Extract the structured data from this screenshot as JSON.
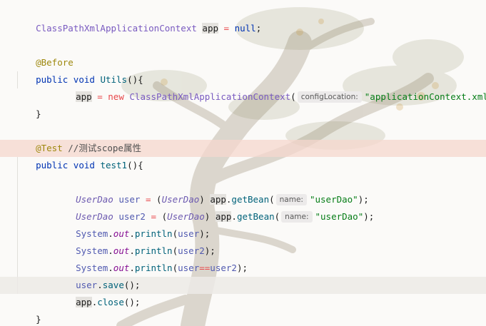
{
  "code": {
    "line1": {
      "type": "ClassPathXmlApplicationContext",
      "var": "app",
      "op": "=",
      "value": "null",
      "end": ";"
    },
    "line3": {
      "annotation": "@Before"
    },
    "line4": {
      "kw1": "public",
      "kw2": "void",
      "method": "Utils",
      "rest": "(){"
    },
    "line5": {
      "var": "app",
      "op": "=",
      "kw": "new",
      "type": "ClassPathXmlApplicationContext",
      "open": "(",
      "hint": "configLocation:",
      "str": "\"applicationContext.xml\"",
      "close": ");"
    },
    "line6": {
      "brace": "}"
    },
    "line8": {
      "annotation": "@Test",
      "comment": "//测试scope属性"
    },
    "line9": {
      "kw1": "public",
      "kw2": "void",
      "method": "test1",
      "rest": "(){"
    },
    "line11": {
      "type": "UserDao",
      "var": "user",
      "op": "=",
      "cast_open": "(",
      "cast_type": "UserDao",
      "cast_close": ")",
      "target": "app",
      "method": "getBean",
      "open": "(",
      "hint": "name:",
      "str": "\"userDao\"",
      "close": ");"
    },
    "line12": {
      "type": "UserDao",
      "var": "user2",
      "op": "=",
      "cast_open": "(",
      "cast_type": "UserDao",
      "cast_close": ")",
      "target": "app",
      "method": "getBean",
      "open": "(",
      "hint": "name:",
      "str": "\"userDao\"",
      "close": ");"
    },
    "line13": {
      "cls": "System",
      "field": "out",
      "method": "println",
      "arg": "user",
      "open": "(",
      "close": ");"
    },
    "line14": {
      "cls": "System",
      "field": "out",
      "method": "println",
      "arg": "user2",
      "open": "(",
      "close": ");"
    },
    "line15": {
      "cls": "System",
      "field": "out",
      "method": "println",
      "open": "(",
      "arg1": "user",
      "op": "==",
      "arg2": "user2",
      "close": ");"
    },
    "line16": {
      "var": "user",
      "method": "save",
      "rest": "();"
    },
    "line17": {
      "var": "app",
      "method": "close",
      "rest": "();"
    },
    "line18": {
      "brace": "}"
    }
  },
  "colors": {
    "keyword": "#0033b3",
    "string": "#067d17",
    "annotation": "#9e880d",
    "method": "#00627a",
    "field": "#871094",
    "error_line": "#f5d7cd"
  }
}
